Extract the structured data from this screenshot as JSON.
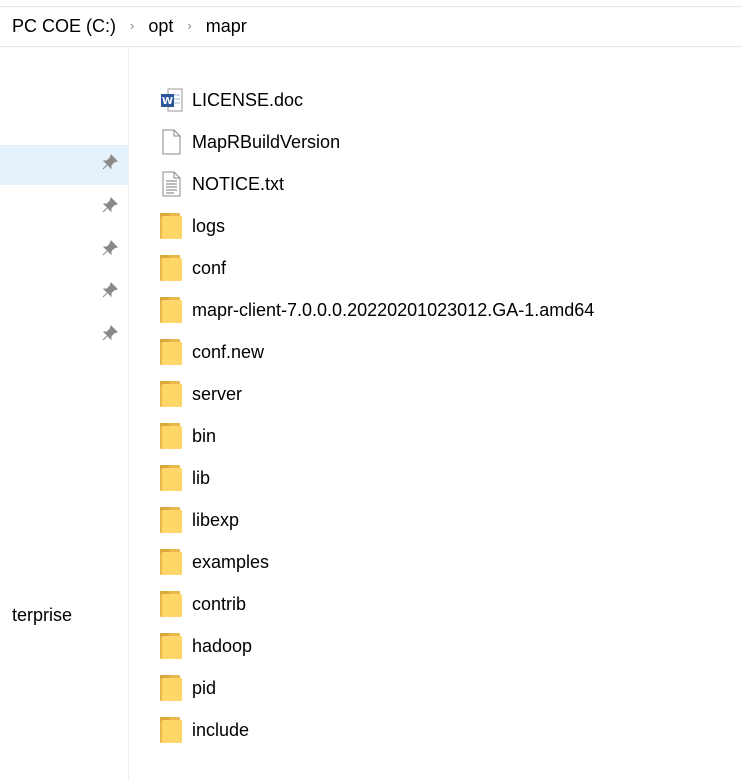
{
  "breadcrumb": {
    "items": [
      "PC COE (C:)",
      "opt",
      "mapr"
    ],
    "separator": "›"
  },
  "navpane": {
    "partial_label": "terprise",
    "pinned_count": 5
  },
  "files": [
    {
      "name": "LICENSE.doc",
      "icon": "word-document-icon"
    },
    {
      "name": "MapRBuildVersion",
      "icon": "blank-file-icon"
    },
    {
      "name": "NOTICE.txt",
      "icon": "text-file-icon"
    },
    {
      "name": "logs",
      "icon": "folder-icon"
    },
    {
      "name": "conf",
      "icon": "folder-icon"
    },
    {
      "name": "mapr-client-7.0.0.0.20220201023012.GA-1.amd64",
      "icon": "folder-icon"
    },
    {
      "name": "conf.new",
      "icon": "folder-icon"
    },
    {
      "name": "server",
      "icon": "folder-icon"
    },
    {
      "name": "bin",
      "icon": "folder-icon"
    },
    {
      "name": "lib",
      "icon": "folder-icon"
    },
    {
      "name": "libexp",
      "icon": "folder-icon"
    },
    {
      "name": "examples",
      "icon": "folder-icon"
    },
    {
      "name": "contrib",
      "icon": "folder-icon"
    },
    {
      "name": "hadoop",
      "icon": "folder-icon"
    },
    {
      "name": "pid",
      "icon": "folder-icon"
    },
    {
      "name": "include",
      "icon": "folder-icon"
    }
  ],
  "colors": {
    "folder": "#ffd769",
    "selection": "#e5f1fb",
    "word_blue": "#2b579a"
  }
}
